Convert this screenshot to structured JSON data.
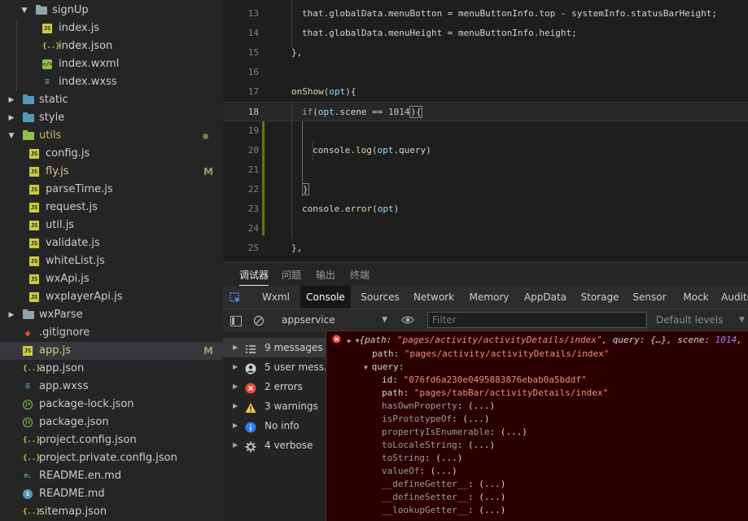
{
  "sidebar": {
    "items": [
      {
        "label": "signUp",
        "type": "folder",
        "color": "#90a4ae",
        "open": true
      },
      {
        "label": "index.js",
        "type": "js"
      },
      {
        "label": "index.json",
        "type": "json"
      },
      {
        "label": "index.wxml",
        "type": "wxml"
      },
      {
        "label": "index.wxss",
        "type": "wxss"
      },
      {
        "label": "static",
        "type": "folder",
        "color": "#519aba",
        "open": false
      },
      {
        "label": "style",
        "type": "folder",
        "color": "#519aba",
        "open": false
      },
      {
        "label": "utils",
        "type": "folder",
        "color": "#8dc149",
        "open": true,
        "modified_dot": true
      },
      {
        "label": "config.js",
        "type": "js"
      },
      {
        "label": "fly.js",
        "type": "js",
        "badge": "M"
      },
      {
        "label": "parseTime.js",
        "type": "js"
      },
      {
        "label": "request.js",
        "type": "js"
      },
      {
        "label": "util.js",
        "type": "js"
      },
      {
        "label": "validate.js",
        "type": "js"
      },
      {
        "label": "whiteList.js",
        "type": "js"
      },
      {
        "label": "wxApi.js",
        "type": "js"
      },
      {
        "label": "wxplayerApi.js",
        "type": "js"
      },
      {
        "label": "wxParse",
        "type": "folder",
        "color": "#90a4ae",
        "open": false
      },
      {
        "label": ".gitignore",
        "type": "git"
      },
      {
        "label": "app.js",
        "type": "js",
        "badge": "M",
        "selected": true
      },
      {
        "label": "app.json",
        "type": "json"
      },
      {
        "label": "app.wxss",
        "type": "wxss"
      },
      {
        "label": "package-lock.json",
        "type": "pkg"
      },
      {
        "label": "package.json",
        "type": "pkg"
      },
      {
        "label": "project.config.json",
        "type": "json"
      },
      {
        "label": "project.private.config.json",
        "type": "json"
      },
      {
        "label": "README.en.md",
        "type": "md"
      },
      {
        "label": "README.md",
        "type": "info"
      },
      {
        "label": "sitemap.json",
        "type": "json"
      }
    ]
  },
  "editor": {
    "lines": [
      {
        "num": "13",
        "indent": 1,
        "tokens": [
          [
            "plain",
            "that.globalData.menuBotton = menuButtonInfo.top - systemInfo.statusBarHeight;"
          ]
        ]
      },
      {
        "num": "14",
        "indent": 1,
        "tokens": [
          [
            "plain",
            "that.globalData.menuHeight = menuButtonInfo.height;"
          ]
        ]
      },
      {
        "num": "15",
        "indent": 0,
        "tokens": [
          [
            "plain",
            "},"
          ]
        ]
      },
      {
        "num": "16",
        "indent": 0,
        "tokens": []
      },
      {
        "num": "17",
        "indent": 0,
        "tokens": [
          [
            "fn",
            "onShow"
          ],
          [
            "plain",
            "("
          ],
          [
            "var",
            "opt"
          ],
          [
            "plain",
            "){"
          ]
        ]
      },
      {
        "num": "18",
        "indent": 1,
        "tokens": [
          [
            "kw",
            "if"
          ],
          [
            "plain",
            "("
          ],
          [
            "var",
            "opt"
          ],
          [
            "plain",
            ".scene == "
          ],
          [
            "num",
            "1014"
          ],
          [
            "plain",
            "){"
          ]
        ],
        "current": true
      },
      {
        "num": "19",
        "indent": 1,
        "tokens": []
      },
      {
        "num": "20",
        "indent": 2,
        "tokens": [
          [
            "plain",
            "console."
          ],
          [
            "fn",
            "log"
          ],
          [
            "plain",
            "("
          ],
          [
            "var",
            "opt"
          ],
          [
            "plain",
            ".query)"
          ]
        ]
      },
      {
        "num": "21",
        "indent": 1,
        "tokens": []
      },
      {
        "num": "22",
        "indent": 1,
        "tokens": [
          [
            "plain",
            "}"
          ]
        ]
      },
      {
        "num": "23",
        "indent": 1,
        "tokens": [
          [
            "plain",
            "console."
          ],
          [
            "fn",
            "error"
          ],
          [
            "plain",
            "("
          ],
          [
            "var",
            "opt"
          ],
          [
            "plain",
            ")"
          ]
        ]
      },
      {
        "num": "24",
        "indent": 1,
        "tokens": []
      },
      {
        "num": "25",
        "indent": 0,
        "tokens": [
          [
            "plain",
            "},"
          ]
        ]
      }
    ]
  },
  "devtools": {
    "top_tabs": [
      "调试器",
      "问题",
      "输出",
      "终端"
    ],
    "active_top_tab": 0,
    "tabs": [
      "Wxml",
      "Console",
      "Sources",
      "Network",
      "Memory",
      "AppData",
      "Storage",
      "Sensor",
      "Mock",
      "Audits"
    ],
    "active_tab": 1,
    "context": "appservice",
    "filter_placeholder": "Filter",
    "levels": "Default levels",
    "levels_arrow": "▼",
    "context_arrow": "▼",
    "sidebar": [
      {
        "label": "9 messages",
        "icon": "list-icon",
        "active": true
      },
      {
        "label": "5 user mess...",
        "icon": "user-icon"
      },
      {
        "label": "2 errors",
        "icon": "error-icon"
      },
      {
        "label": "3 warnings",
        "icon": "warning-icon"
      },
      {
        "label": "No info",
        "icon": "info-icon"
      },
      {
        "label": "4 verbose",
        "icon": "verbose-icon"
      }
    ],
    "console": {
      "summary": {
        "open": "{",
        "path_key": "path",
        "path_val": "\"pages/activity/activityDetails/index\"",
        "query_key": "query",
        "query_val": "{…}",
        "scene_key": "scene",
        "scene_val": "1014",
        "trail": ","
      },
      "path_line": {
        "key": "path",
        "val": "\"pages/activity/activityDetails/index\""
      },
      "query_label": "query",
      "query_id": {
        "key": "id",
        "val": "\"076fd6a230e0495883876ebab0a5bddf\""
      },
      "query_path": {
        "key": "path",
        "val": "\"pages/tabBar/activityDetails/index\""
      },
      "proto": [
        "hasOwnProperty",
        "isPrototypeOf",
        "propertyIsEnumerable",
        "toLocaleString",
        "toString",
        "valueOf",
        "__defineGetter__",
        "__defineSetter__",
        "__lookupGetter__"
      ],
      "proto_value": "(...)"
    }
  }
}
